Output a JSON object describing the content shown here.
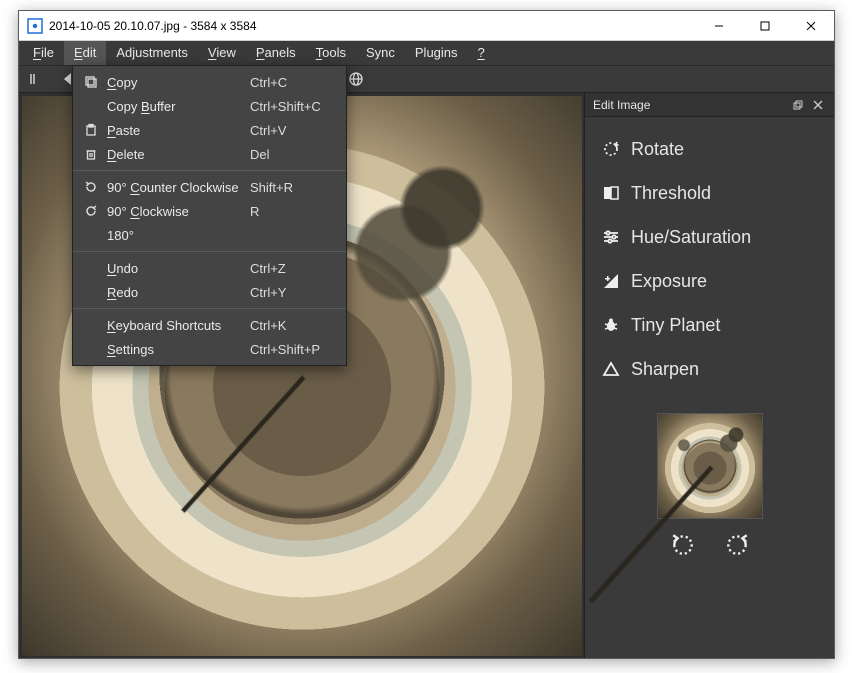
{
  "window": {
    "title": "2014-10-05 20.10.07.jpg  - 3584 x 3584"
  },
  "menubar": {
    "items": [
      {
        "label": "File",
        "ul": 0
      },
      {
        "label": "Edit",
        "ul": 0
      },
      {
        "label": "Adjustments",
        "ul": -1
      },
      {
        "label": "View",
        "ul": 0
      },
      {
        "label": "Panels",
        "ul": 0
      },
      {
        "label": "Tools",
        "ul": 0
      },
      {
        "label": "Sync",
        "ul": -1
      },
      {
        "label": "Plugins",
        "ul": -1
      },
      {
        "label": "?",
        "ul": 0
      }
    ],
    "open_index": 1
  },
  "edit_menu": {
    "groups": [
      [
        {
          "icon": "copy-icon",
          "label": "Copy",
          "ul": 0,
          "shortcut": "Ctrl+C"
        },
        {
          "icon": "",
          "label": "Copy Buffer",
          "ul": 5,
          "shortcut": "Ctrl+Shift+C"
        },
        {
          "icon": "paste-icon",
          "label": "Paste",
          "ul": 0,
          "shortcut": "Ctrl+V"
        },
        {
          "icon": "delete-icon",
          "label": "Delete",
          "ul": 0,
          "shortcut": "Del"
        }
      ],
      [
        {
          "icon": "rotate-ccw-icon",
          "label": "90° Counter Clockwise",
          "ul": 4,
          "shortcut": "Shift+R"
        },
        {
          "icon": "rotate-cw-icon",
          "label": "90° Clockwise",
          "ul": 4,
          "shortcut": "R"
        },
        {
          "icon": "",
          "label": "180°",
          "ul": -1,
          "shortcut": ""
        }
      ],
      [
        {
          "icon": "",
          "label": "Undo",
          "ul": 0,
          "shortcut": "Ctrl+Z"
        },
        {
          "icon": "",
          "label": "Redo",
          "ul": 0,
          "shortcut": "Ctrl+Y"
        }
      ],
      [
        {
          "icon": "",
          "label": "Keyboard Shortcuts",
          "ul": 0,
          "shortcut": "Ctrl+K"
        },
        {
          "icon": "",
          "label": "Settings",
          "ul": 0,
          "shortcut": "Ctrl+Shift+P"
        }
      ]
    ]
  },
  "sidepanel": {
    "title": "Edit Image",
    "items": [
      {
        "icon": "rotate-icon",
        "label": "Rotate"
      },
      {
        "icon": "threshold-icon",
        "label": "Threshold"
      },
      {
        "icon": "sliders-icon",
        "label": "Hue/Saturation"
      },
      {
        "icon": "exposure-icon",
        "label": "Exposure"
      },
      {
        "icon": "bug-icon",
        "label": "Tiny Planet"
      },
      {
        "icon": "triangle-icon",
        "label": "Sharpen"
      }
    ]
  },
  "toolbar": {
    "names": [
      "collapse-icon",
      "back-icon",
      "fullscreen-2-icon",
      "refresh-icon",
      "zoom-out-icon",
      "zoom-in-icon",
      "fit-icon",
      "fullscreen-icon",
      "aspect-icon",
      "ratio-1-1-icon",
      "globe-icon"
    ]
  }
}
